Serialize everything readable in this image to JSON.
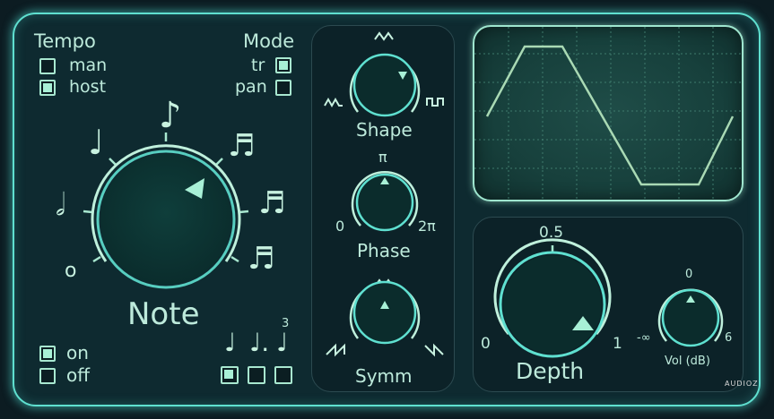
{
  "tempo": {
    "title": "Tempo",
    "options": [
      {
        "label": "man",
        "checked": false
      },
      {
        "label": "host",
        "checked": true
      }
    ]
  },
  "mode": {
    "title": "Mode",
    "options": [
      {
        "label": "tr",
        "checked": true
      },
      {
        "label": "pan",
        "checked": false
      }
    ]
  },
  "note_knob": {
    "label": "Note"
  },
  "power": {
    "options": [
      {
        "label": "on",
        "checked": true
      },
      {
        "label": "off",
        "checked": false
      }
    ]
  },
  "note_type": {
    "triplet_label": "3",
    "options": [
      {
        "name": "straight",
        "checked": true
      },
      {
        "name": "dotted",
        "checked": false
      },
      {
        "name": "triplet",
        "checked": false
      }
    ]
  },
  "shape_knob": {
    "label": "Shape"
  },
  "phase_knob": {
    "label": "Phase",
    "min": "0",
    "mid": "π",
    "max": "2π"
  },
  "symm_knob": {
    "label": "Symm"
  },
  "depth_knob": {
    "label": "Depth",
    "min": "0",
    "mid": "0.5",
    "max": "1"
  },
  "vol_knob": {
    "label": "Vol (dB)",
    "min": "-∞",
    "mid": "0",
    "max": "6"
  },
  "watermark": "AUDIOZ",
  "colors": {
    "accent": "#5fe0d0",
    "knob_fill": "#0e3a38",
    "trace": "#a9d9b4"
  }
}
